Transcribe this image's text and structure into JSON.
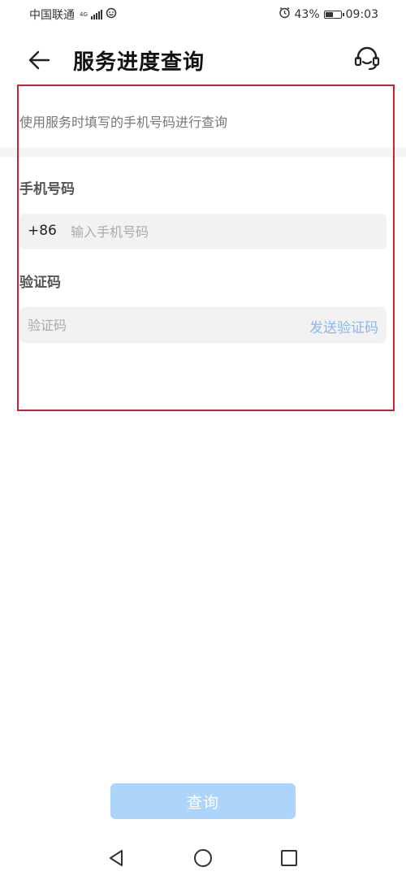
{
  "status_bar": {
    "carrier": "中国联通",
    "network_type": "4G",
    "battery_percent": "43%",
    "time": "09:03",
    "icons": [
      "signal-icon",
      "notification-icon",
      "alarm-icon",
      "battery-icon"
    ]
  },
  "header": {
    "title": "服务进度查询",
    "back_icon": "back-arrow-icon",
    "support_icon": "headset-icon"
  },
  "form": {
    "hint": "使用服务时填写的手机号码进行查询",
    "phone": {
      "label": "手机号码",
      "country_code": "+86",
      "placeholder": "输入手机号码",
      "value": ""
    },
    "code": {
      "label": "验证码",
      "placeholder": "验证码",
      "value": "",
      "send_label": "发送验证码"
    }
  },
  "submit": {
    "label": "查询"
  },
  "nav_bar": {
    "icons": [
      "nav-back-icon",
      "nav-home-icon",
      "nav-recent-icon"
    ]
  },
  "colors": {
    "highlight_border": "#d0202a",
    "submit_bg": "#add4fb",
    "send_code_text": "#8db7e8",
    "field_bg": "#f2f2f2"
  }
}
